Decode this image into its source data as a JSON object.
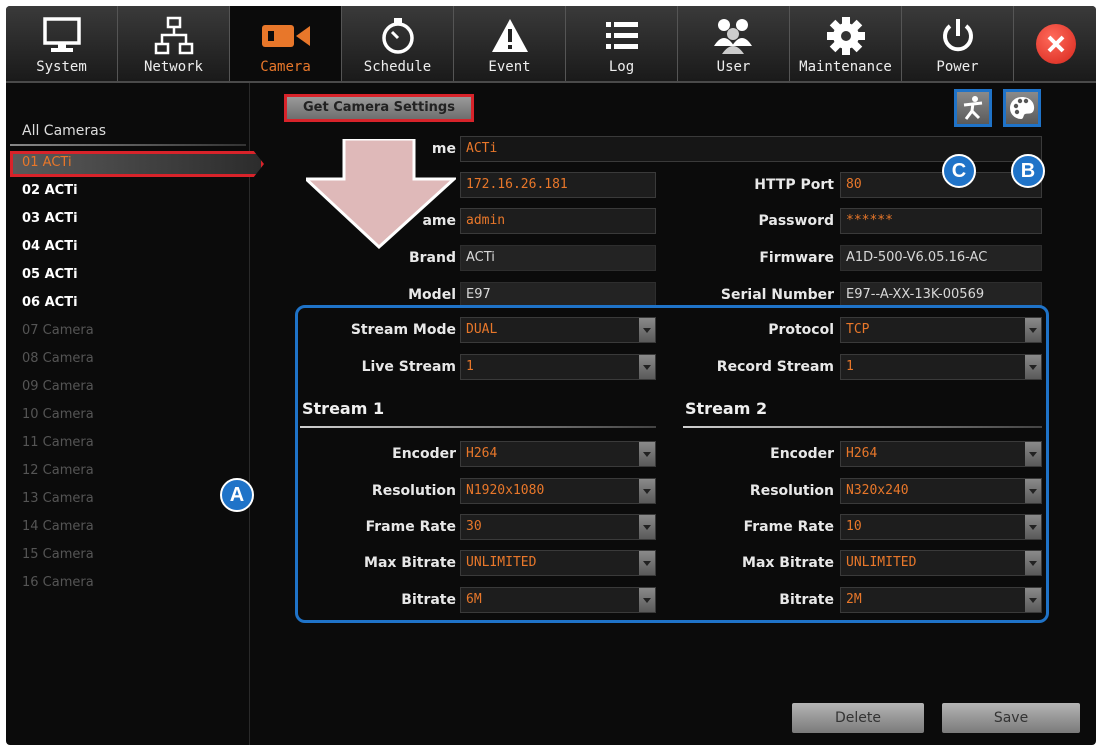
{
  "tabs": [
    {
      "label": "System",
      "icon": "monitor-icon"
    },
    {
      "label": "Network",
      "icon": "network-icon"
    },
    {
      "label": "Camera",
      "icon": "camera-icon",
      "active": true
    },
    {
      "label": "Schedule",
      "icon": "stopwatch-icon"
    },
    {
      "label": "Event",
      "icon": "warning-icon"
    },
    {
      "label": "Log",
      "icon": "list-icon"
    },
    {
      "label": "User",
      "icon": "users-icon"
    },
    {
      "label": "Maintenance",
      "icon": "gear-icon"
    },
    {
      "label": "Power",
      "icon": "power-icon"
    }
  ],
  "sidebar": {
    "title": "All Cameras",
    "cameras": [
      "01 ACTi",
      "02 ACTi",
      "03 ACTi",
      "04 ACTi",
      "05 ACTi",
      "06 ACTi",
      "07 Camera",
      "08 Camera",
      "09 Camera",
      "10 Camera",
      "11 Camera",
      "12 Camera",
      "13 Camera",
      "14 Camera",
      "15 Camera",
      "16 Camera"
    ],
    "selected": "01 ACTi"
  },
  "main": {
    "get_settings": "Get Camera Settings",
    "name_label": "me",
    "name_value": "ACTi",
    "ip_value": "172.16.26.181",
    "http_port_label": "HTTP Port",
    "http_port_value": "80",
    "username_label": "ame",
    "username_value": "admin",
    "password_label": "Password",
    "password_value": "******",
    "brand_label": "Brand",
    "brand_value": "ACTi",
    "firmware_label": "Firmware",
    "firmware_value": "A1D-500-V6.05.16-AC",
    "model_label": "Model",
    "model_value": "E97",
    "serial_label": "Serial Number",
    "serial_value": "E97--A-XX-13K-00569",
    "stream_mode_label": "Stream Mode",
    "stream_mode_value": "DUAL",
    "protocol_label": "Protocol",
    "protocol_value": "TCP",
    "live_stream_label": "Live Stream",
    "live_stream_value": "1",
    "record_stream_label": "Record Stream",
    "record_stream_value": "1"
  },
  "stream1": {
    "title": "Stream 1",
    "encoder_label": "Encoder",
    "encoder": "H264",
    "resolution_label": "Resolution",
    "resolution": "N1920x1080",
    "framerate_label": "Frame Rate",
    "framerate": "30",
    "maxbitrate_label": "Max Bitrate",
    "maxbitrate": "UNLIMITED",
    "bitrate_label": "Bitrate",
    "bitrate": "6M"
  },
  "stream2": {
    "title": "Stream 2",
    "encoder_label": "Encoder",
    "encoder": "H264",
    "resolution_label": "Resolution",
    "resolution": "N320x240",
    "framerate_label": "Frame Rate",
    "framerate": "10",
    "maxbitrate_label": "Max Bitrate",
    "maxbitrate": "UNLIMITED",
    "bitrate_label": "Bitrate",
    "bitrate": "2M"
  },
  "annotations": {
    "a": "A",
    "b": "B",
    "c": "C"
  },
  "actions": {
    "delete": "Delete",
    "save": "Save"
  },
  "colors": {
    "accent": "#e8772a",
    "highlight_red": "#d8232a",
    "annotation_blue": "#1f73c8"
  }
}
